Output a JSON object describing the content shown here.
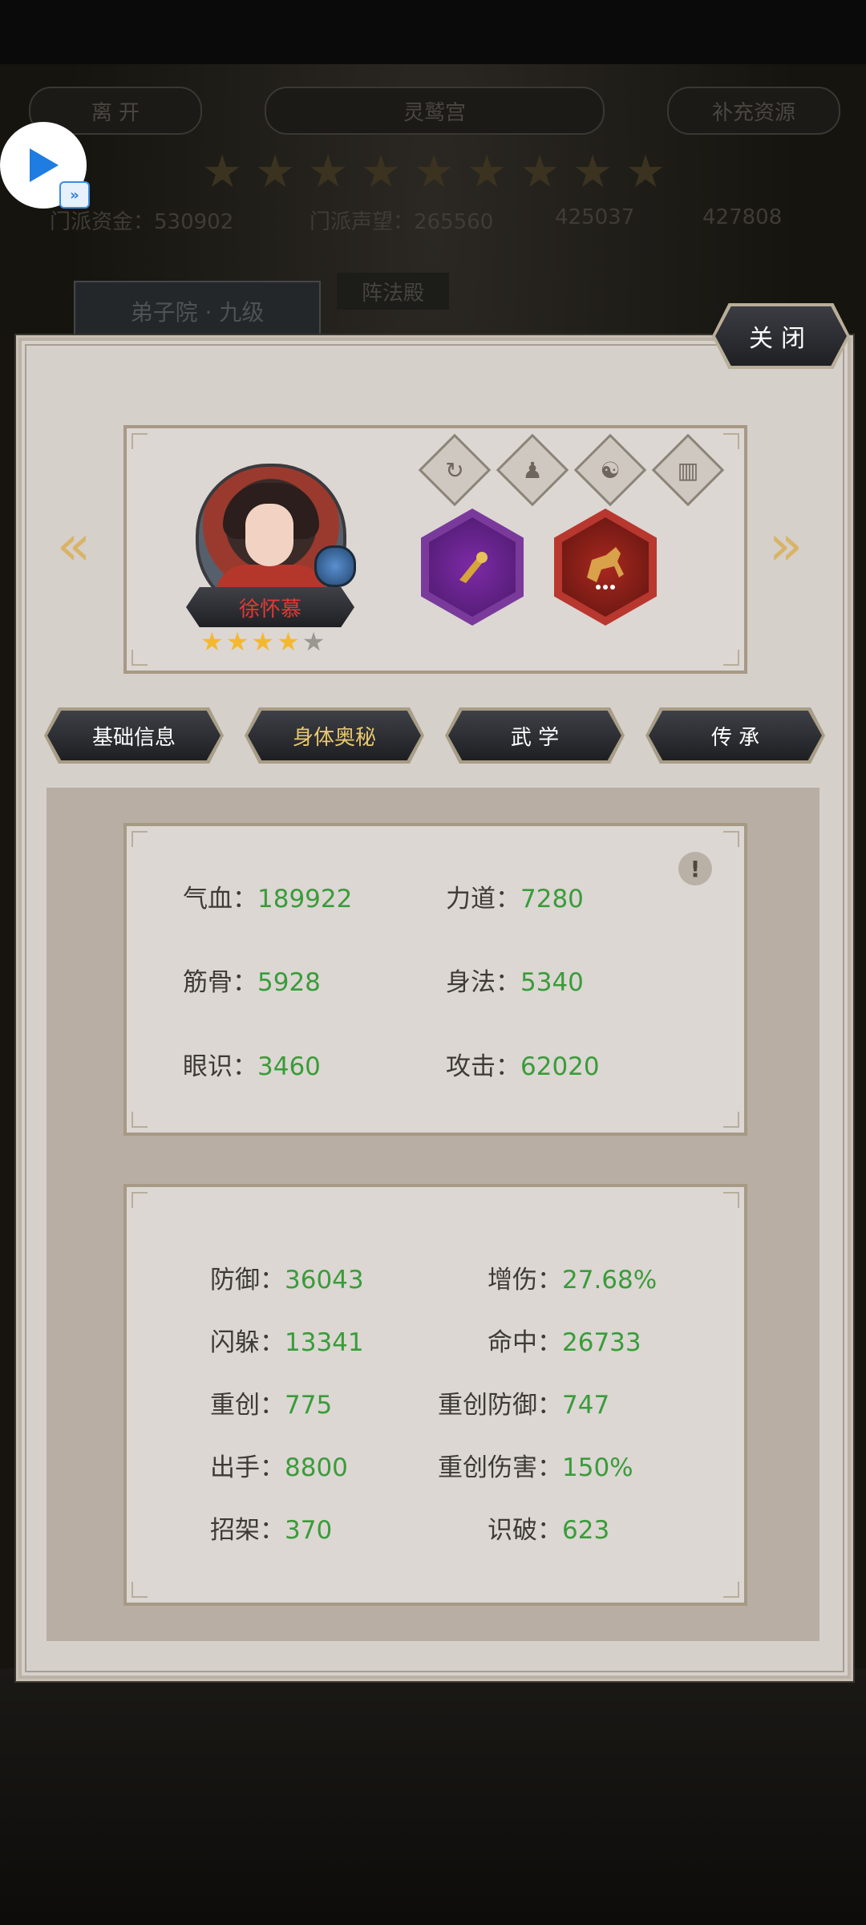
{
  "background": {
    "leave_label": "离 开",
    "location_title": "灵鹫宫",
    "supplement_label": "补充资源",
    "resources": {
      "funds_label": "门派资金：",
      "funds_value": "530902",
      "reputation_label": "门派声望：",
      "reputation_value": "265560",
      "res3": "425037",
      "res4": "427808"
    },
    "building_banner": "弟子院 · 九级",
    "building_banner2": "阵法殿",
    "star_count": 9
  },
  "panel": {
    "close_label": "关闭",
    "character": {
      "name": "徐怀慕",
      "stars": 4,
      "max_stars": 5
    },
    "skill_tabs": [
      "refresh-icon",
      "person-icon",
      "yin-yang-icon",
      "book-icon"
    ],
    "equipment": [
      {
        "name": "weapon-icon",
        "color": "#7b2fa0"
      },
      {
        "name": "horse-icon",
        "color": "#a8281f"
      }
    ],
    "sections": [
      {
        "label": "基础信息",
        "active": false
      },
      {
        "label": "身体奥秘",
        "active": true
      },
      {
        "label": "武 学",
        "active": false
      },
      {
        "label": "传 承",
        "active": false
      }
    ],
    "basic_stats": [
      {
        "label": "气血：",
        "value": "189922"
      },
      {
        "label": "力道：",
        "value": "7280"
      },
      {
        "label": "筋骨：",
        "value": "5928"
      },
      {
        "label": "身法：",
        "value": "5340"
      },
      {
        "label": "眼识：",
        "value": "3460"
      },
      {
        "label": "攻击：",
        "value": "62020"
      }
    ],
    "advanced_stats": [
      {
        "label": "防御：",
        "value": "36043"
      },
      {
        "label": "增伤：",
        "value": "27.68%"
      },
      {
        "label": "闪躲：",
        "value": "13341"
      },
      {
        "label": "命中：",
        "value": "26733"
      },
      {
        "label": "重创：",
        "value": "775"
      },
      {
        "label": "重创防御：",
        "value": "747"
      },
      {
        "label": "出手：",
        "value": "8800"
      },
      {
        "label": "重创伤害：",
        "value": "150%"
      },
      {
        "label": "招架：",
        "value": "370"
      },
      {
        "label": "识破：",
        "value": "623"
      }
    ],
    "info_icon_text": "!"
  },
  "colors": {
    "stat_value": "#3a9c3a",
    "active_section": "#e9c86e",
    "name": "#e03a34",
    "star": "#f4b830"
  }
}
